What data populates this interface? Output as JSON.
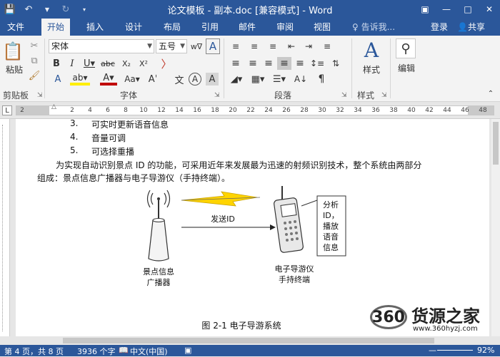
{
  "window": {
    "title": "论文模板 - 副本.doc [兼容模式] - Word"
  },
  "tabs": [
    {
      "label": "文件"
    },
    {
      "label": "开始"
    },
    {
      "label": "插入"
    },
    {
      "label": "设计"
    },
    {
      "label": "布局"
    },
    {
      "label": "引用"
    },
    {
      "label": "邮件"
    },
    {
      "label": "审阅"
    },
    {
      "label": "视图"
    }
  ],
  "tell_me": "♀ 告诉我...",
  "login": "登录",
  "share": "共享",
  "ribbon": {
    "clipboard": {
      "paste": "粘贴",
      "label": "剪贴板"
    },
    "font": {
      "name": "宋体",
      "size": "五号",
      "label": "字体"
    },
    "paragraph": {
      "label": "段落"
    },
    "styles": {
      "button": "样式",
      "label": "样式"
    },
    "editing": {
      "button": "编辑"
    }
  },
  "ruler": {
    "ticks": [
      "2",
      "2",
      "4",
      "6",
      "8",
      "10",
      "12",
      "14",
      "16",
      "18",
      "20",
      "22",
      "24",
      "26",
      "28",
      "30",
      "32",
      "34",
      "36",
      "38",
      "40",
      "42",
      "44",
      "46",
      "48"
    ]
  },
  "document": {
    "list": [
      {
        "num": "3.",
        "text": "可实时更新语音信息"
      },
      {
        "num": "4.",
        "text": "音量可调"
      },
      {
        "num": "5.",
        "text": "可选择重播"
      }
    ],
    "paragraph_line1": "为实现自动识别景点 ID 的功能，可采用近年来发展最为迅速的射频识别技术，整个系统由两部分",
    "paragraph_line2": "组成：景点信息广播器与电子导游仪（手持终端）。",
    "figure": {
      "arrow_label": "发送ID",
      "broadcaster_label_1": "景点信息",
      "broadcaster_label_2": "广播器",
      "guide_label_1": "电子导游仪",
      "guide_label_2": "手持终端",
      "callout": [
        "分析",
        "ID，",
        "播放",
        "语音",
        "信息"
      ],
      "caption": "图  2-1    电子导游系统"
    }
  },
  "status": {
    "page": "第 4 页，共 8 页",
    "words": "3936 个字",
    "language": "中文(中国)",
    "zoom": "92%"
  },
  "watermark": {
    "logo": "360",
    "name": "货源之家",
    "url": "www.360hyzj.com"
  }
}
